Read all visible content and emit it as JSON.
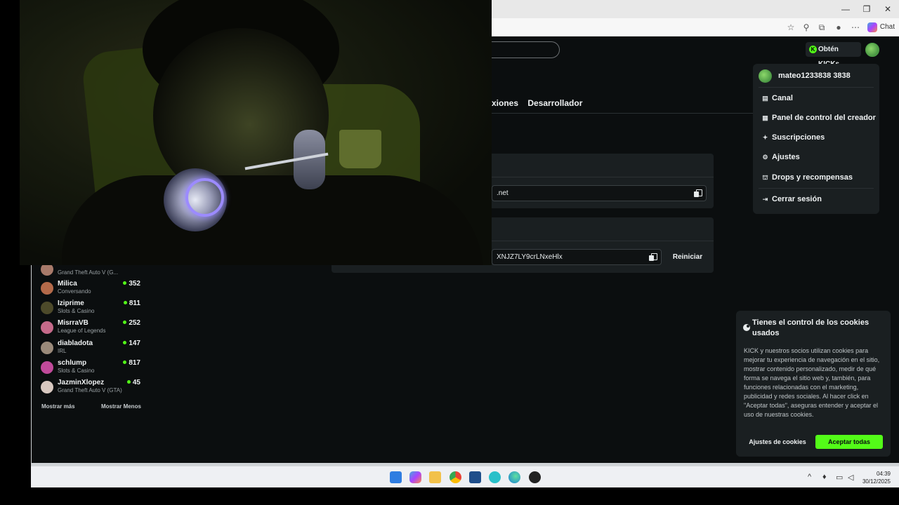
{
  "browser": {
    "chat_label": "Chat"
  },
  "header": {
    "get_kicks_label": "Obtén KICKs"
  },
  "tabs": [
    "xiones",
    "Desarrollador"
  ],
  "fields": {
    "url_value": ".net",
    "key_value": "XNJZ7LY9crLNxeHlx",
    "reset_label": "Reiniciar"
  },
  "user_menu": {
    "username": "mateo1233838 3838",
    "items": [
      {
        "label": "Canal",
        "icon": "channel-icon"
      },
      {
        "label": "Panel de control del creador",
        "icon": "dashboard-icon"
      },
      {
        "label": "Suscripciones",
        "icon": "star-icon"
      },
      {
        "label": "Ajustes",
        "icon": "gear-icon"
      },
      {
        "label": "Drops y recompensas",
        "icon": "gift-icon"
      },
      {
        "label": "Cerrar sesión",
        "icon": "logout-icon"
      }
    ]
  },
  "recommended": {
    "items": [
      {
        "name": "",
        "category": "Grand Theft Auto V (G...",
        "count": "",
        "color": "#a87a6a"
      },
      {
        "name": "Milica",
        "category": "Conversando",
        "count": "352",
        "color": "#b46a4a"
      },
      {
        "name": "Iziprime",
        "category": "Slots & Casino",
        "count": "811",
        "color": "#4d4a2a"
      },
      {
        "name": "MisrraVB",
        "category": "League of Legends",
        "count": "252",
        "color": "#c56a8a"
      },
      {
        "name": "diabladota",
        "category": "IRL",
        "count": "147",
        "color": "#9a8a7a"
      },
      {
        "name": "schlump",
        "category": "Slots & Casino",
        "count": "817",
        "color": "#c04a9a"
      },
      {
        "name": "JazminXlopez",
        "category": "Grand Theft Auto V (GTA)",
        "count": "45",
        "color": "#d8c8c0"
      }
    ],
    "show_more": "Mostrar más",
    "show_less": "Mostrar Menos"
  },
  "cookies": {
    "title": "Tienes el control de los cookies usados",
    "body": "KICK y nuestros socios utilizan cookies para mejorar tu experiencia de navegación en el sitio, mostrar contenido personalizado, medir de qué forma se navega el sitio web y, también, para funciones relacionadas con el marketing, publicidad y redes sociales. Al hacer click en \"Aceptar todas\", aseguras entender y aceptar el uso de nuestras cookies.",
    "settings_label": "Ajustes de cookies",
    "accept_label": "Aceptar todas"
  },
  "taskbar": {
    "time": "04:39",
    "date": "30/12/2025"
  },
  "colors": {
    "accent": "#53fc18",
    "page_bg": "#0b0e0f",
    "card_bg": "#1a1f21"
  }
}
